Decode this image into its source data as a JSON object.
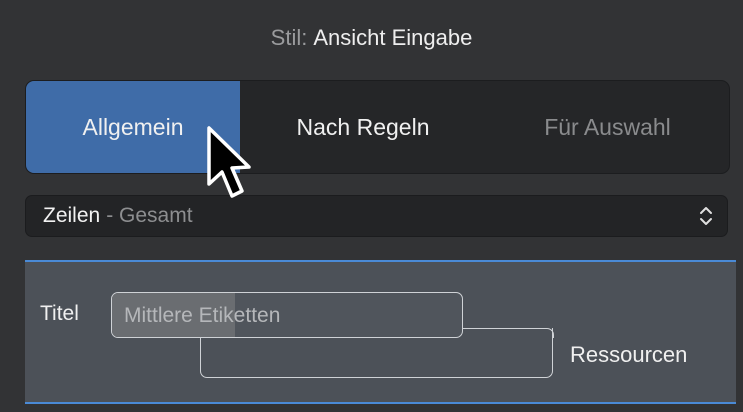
{
  "header": {
    "label": "Stil:",
    "value": "Ansicht Eingabe"
  },
  "tabs": [
    {
      "label": "Allgemein",
      "selected": true
    },
    {
      "label": "Nach Regeln",
      "selected": false
    },
    {
      "label": "Für Auswahl",
      "selected": false
    }
  ],
  "select": {
    "value": "Zeilen",
    "detail": "- Gesamt",
    "icon": "chevron-up-down-icon"
  },
  "editor": {
    "title_label": "Titel",
    "field_value": "Mittlere Etiketten",
    "resources_label": "Ressourcen"
  },
  "colors": {
    "accent": "#3f6ca8",
    "focus_border": "#4a8ad6"
  }
}
